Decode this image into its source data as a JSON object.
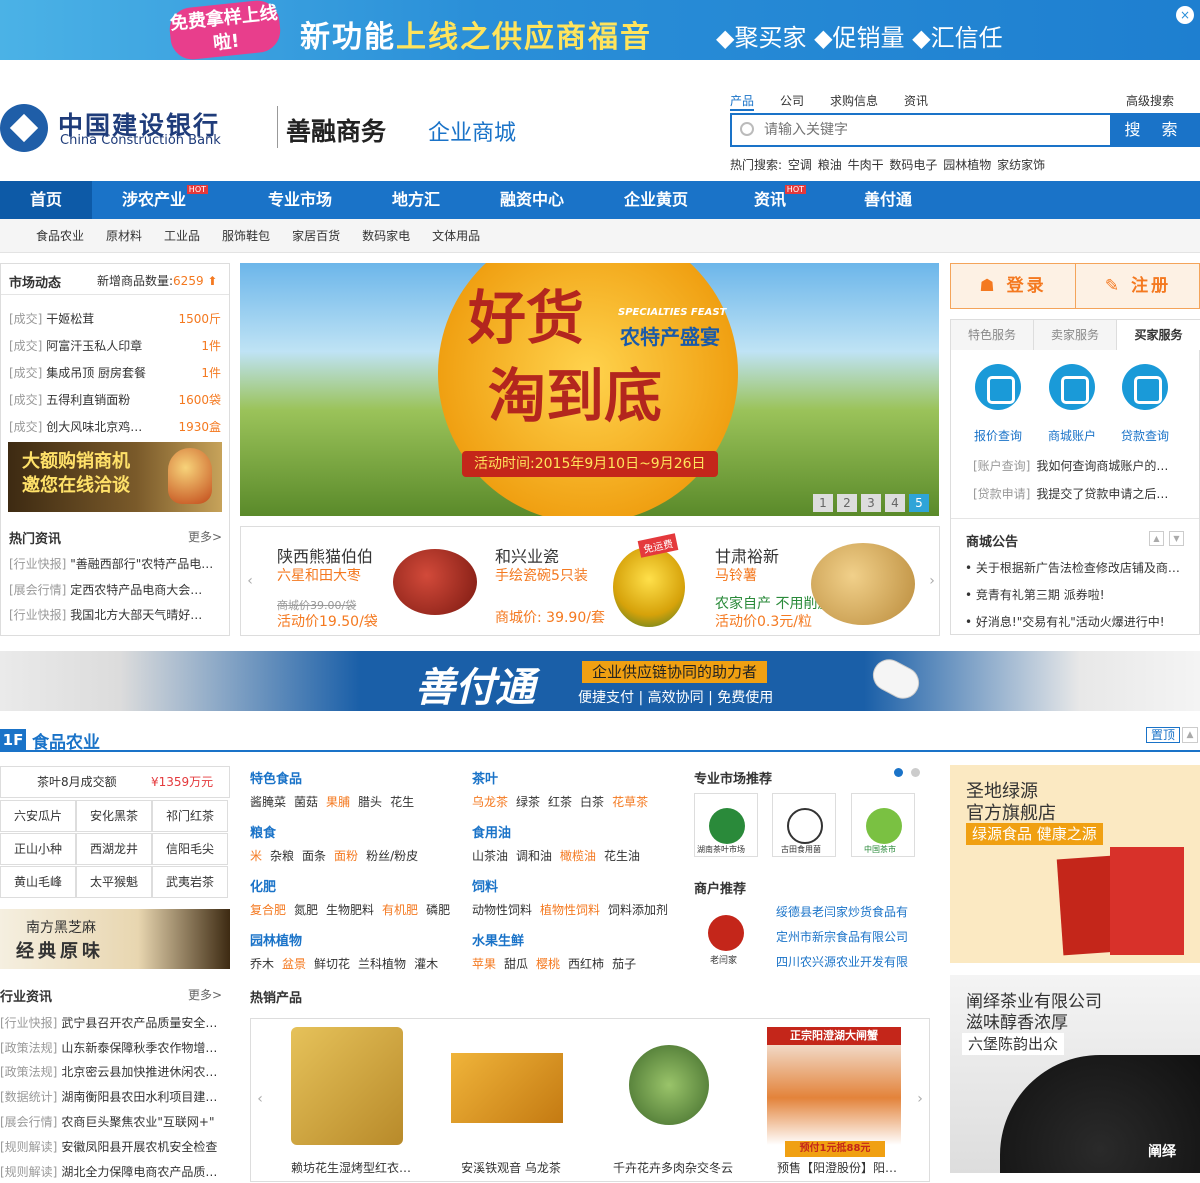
{
  "top_banner": {
    "badge": "免费拿样上线啦!",
    "headline_a": "新功能",
    "headline_b": "上线之供应商福音",
    "slogan": "◆聚买家 ◆促销量 ◆汇信任"
  },
  "header": {
    "logo_cn": "中国建设银行",
    "logo_en": "China Construction Bank",
    "brand_main": "善融商务",
    "brand_sub": "企业商城"
  },
  "search": {
    "tabs": [
      "产品",
      "公司",
      "求购信息",
      "资讯"
    ],
    "advanced": "高级搜索",
    "placeholder": "请输入关键字",
    "button": "搜 索",
    "hot_label": "热门搜索:",
    "hot_words": [
      "空调",
      "粮油",
      "牛肉干",
      "数码电子",
      "园林植物",
      "家纺家饰"
    ]
  },
  "nav": {
    "items": [
      "首页",
      "涉农产业",
      "专业市场",
      "地方汇",
      "融资中心",
      "企业黄页",
      "资讯",
      "善付通"
    ],
    "hot_tag": "HOT"
  },
  "subnav": [
    "食品农业",
    "原材料",
    "工业品",
    "服饰鞋包",
    "家居百货",
    "数码家电",
    "文体用品"
  ],
  "market": {
    "title": "市场动态",
    "new_label": "新增商品数量:",
    "new_count": "6259",
    "deals": [
      {
        "tag": "[成交]",
        "name": "干姬松茸",
        "qty": "1500斤"
      },
      {
        "tag": "[成交]",
        "name": "阿富汗玉私人印章",
        "qty": "1件"
      },
      {
        "tag": "[成交]",
        "name": "集成吊顶 厨房套餐",
        "qty": "1件"
      },
      {
        "tag": "[成交]",
        "name": "五得利直销面粉",
        "qty": "1600袋"
      },
      {
        "tag": "[成交]",
        "name": "创大风味北京鸡…",
        "qty": "1930盒"
      }
    ],
    "ad_line1": "大额购销商机",
    "ad_line2": "邀您在线洽谈",
    "news_title": "热门资讯",
    "more": "更多>",
    "news": [
      {
        "tag": "[行业快报]",
        "text": "\"善融西部行\"农特产品电…"
      },
      {
        "tag": "[展会行情]",
        "text": "定西农特产品电商大会…"
      },
      {
        "tag": "[行业快报]",
        "text": "我国北方大部天气晴好…"
      }
    ]
  },
  "hero": {
    "title1": "好货",
    "title2": "淘到底",
    "en": "SPECIALTIES FEAST",
    "cn": "农特产盛宴",
    "date": "活动时间:2015年9月10日~9月26日",
    "pages": [
      "1",
      "2",
      "3",
      "4",
      "5"
    ],
    "active_page": 5
  },
  "featured": [
    {
      "name": "陕西熊猫伯伯",
      "sub": "六星和田大枣",
      "old": "商城价39.00/袋",
      "price": "活动价19.50/袋"
    },
    {
      "name": "和兴业瓷",
      "sub": "手绘瓷碗5只装",
      "badge": "免运费",
      "price": "商城价: 39.90/套"
    },
    {
      "name": "甘肃裕新",
      "sub": "马铃薯",
      "sub2": "农家自产  不用削皮",
      "price": "活动价0.3元/粒"
    }
  ],
  "account": {
    "login": "登录",
    "register": "注册",
    "tabs": [
      "特色服务",
      "卖家服务",
      "买家服务"
    ],
    "services": [
      "报价查询",
      "商城账户",
      "贷款查询"
    ],
    "qa": [
      {
        "tag": "[账户查询]",
        "text": "我如何查询商城账户的…"
      },
      {
        "tag": "[贷款申请]",
        "text": "我提交了贷款申请之后…"
      }
    ],
    "notice_title": "商城公告",
    "notices": [
      "关于根据新广告法检查修改店铺及商…",
      "竞青有礼第三期 派券啦!",
      "好消息!\"交易有礼\"活动火爆进行中!"
    ]
  },
  "sft_banner": {
    "title": "善付通",
    "tagline": "企业供应链协同的助力者",
    "features": "便捷支付 | 高效协同 | 免费使用"
  },
  "floor": {
    "num": "1F",
    "name": "食品农业",
    "top": "置顶",
    "tea_head_label": "茶叶8月成交额",
    "tea_head_value": "¥1359万元",
    "tea_cells": [
      "六安瓜片",
      "安化黑茶",
      "祁门红茶",
      "正山小种",
      "西湖龙井",
      "信阳毛尖",
      "黄山毛峰",
      "太平猴魁",
      "武夷岩茶"
    ],
    "sesame_line1": "南方黑芝麻",
    "sesame_line2": "经典原味",
    "news_title": "行业资讯",
    "more": "更多>",
    "news": [
      {
        "tag": "[行业快报]",
        "text": "武宁县召开农产品质量安全…"
      },
      {
        "tag": "[政策法规]",
        "text": "山东新泰保障秋季农作物增…"
      },
      {
        "tag": "[政策法规]",
        "text": "北京密云县加快推进休闲农…"
      },
      {
        "tag": "[数据统计]",
        "text": "湖南衡阳县农田水利项目建…"
      },
      {
        "tag": "[展会行情]",
        "text": "农商巨头聚焦农业\"互联网+\""
      },
      {
        "tag": "[规则解读]",
        "text": "安徽凤阳县开展农机安全检查"
      },
      {
        "tag": "[规则解读]",
        "text": "湖北全力保障电商农产品质…"
      }
    ],
    "categories": [
      {
        "title": "特色食品",
        "items": [
          {
            "t": "酱腌菜"
          },
          {
            "t": "菌菇"
          },
          {
            "t": "果脯",
            "hl": true
          },
          {
            "t": "腊头"
          },
          {
            "t": "花生"
          }
        ]
      },
      {
        "title": "茶叶",
        "items": [
          {
            "t": "乌龙茶",
            "hl": true
          },
          {
            "t": "绿茶"
          },
          {
            "t": "红茶"
          },
          {
            "t": "白茶"
          },
          {
            "t": "花草茶",
            "hl": true
          }
        ]
      },
      {
        "title": "粮食",
        "items": [
          {
            "t": "米",
            "hl": true
          },
          {
            "t": "杂粮"
          },
          {
            "t": "面条"
          },
          {
            "t": "面粉",
            "hl": true
          },
          {
            "t": "粉丝/粉皮"
          }
        ]
      },
      {
        "title": "食用油",
        "items": [
          {
            "t": "山茶油"
          },
          {
            "t": "调和油"
          },
          {
            "t": "橄榄油",
            "hl": true
          },
          {
            "t": "花生油"
          }
        ]
      },
      {
        "title": "化肥",
        "items": [
          {
            "t": "复合肥",
            "hl": true
          },
          {
            "t": "氮肥"
          },
          {
            "t": "生物肥料"
          },
          {
            "t": "有机肥",
            "hl": true
          },
          {
            "t": "磷肥"
          }
        ]
      },
      {
        "title": "饲料",
        "items": [
          {
            "t": "动物性饲料"
          },
          {
            "t": "植物性饲料",
            "hl": true
          },
          {
            "t": "饲料添加剂"
          }
        ]
      },
      {
        "title": "园林植物",
        "items": [
          {
            "t": "乔木"
          },
          {
            "t": "盆景",
            "hl": true
          },
          {
            "t": "鲜切花"
          },
          {
            "t": "兰科植物"
          },
          {
            "t": "灌木"
          }
        ]
      },
      {
        "title": "水果生鲜",
        "items": [
          {
            "t": "苹果",
            "hl": true
          },
          {
            "t": "甜瓜"
          },
          {
            "t": "樱桃",
            "hl": true
          },
          {
            "t": "西红柿"
          },
          {
            "t": "茄子"
          }
        ]
      }
    ],
    "market_rec_title": "专业市场推荐",
    "market_logos": [
      "湖南茶叶市场",
      "古田食用菌",
      "中国茶市"
    ],
    "shop_rec_title": "商户推荐",
    "shop_logo": "老闫家",
    "shops": [
      "绥德县老闫家炒货食品有",
      "定州市新宗食品有限公司",
      "四川农兴源农业开发有限"
    ],
    "hot_title": "热销产品",
    "hot_products": [
      "赖坊花生湿烤型红衣…",
      "安溪铁观音 乌龙茶",
      "千卉花卉多肉杂交冬云",
      "预售【阳澄股份】阳…"
    ],
    "crab_banner_top": "正宗阳澄湖大闸蟹",
    "crab_banner_bottom": "预付1元抵88元",
    "ad1_line1": "圣地绿源",
    "ad1_line2": "官方旗舰店",
    "ad1_line3": "绿源食品 健康之源",
    "ad2_line1": "阐绎茶业有限公司",
    "ad2_line2": "滋味醇香浓厚",
    "ad2_line3": "六堡陈韵出众",
    "ad2_logo": "阐绎"
  }
}
